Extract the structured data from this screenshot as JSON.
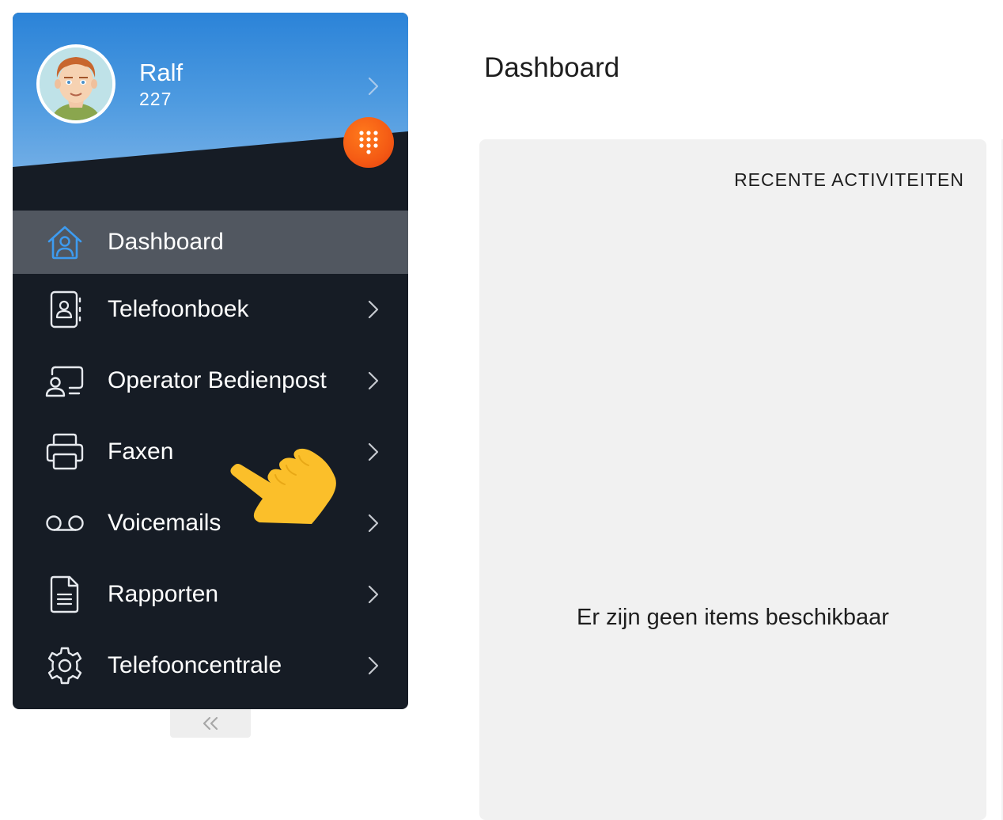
{
  "user": {
    "name": "Ralf",
    "extension": "227"
  },
  "nav": {
    "items": [
      {
        "label": "Dashboard",
        "icon": "home-icon",
        "active": true
      },
      {
        "label": "Telefoonboek",
        "icon": "contact-book-icon"
      },
      {
        "label": "Operator Bedienpost",
        "icon": "operator-console-icon"
      },
      {
        "label": "Faxen",
        "icon": "printer-icon"
      },
      {
        "label": "Voicemails",
        "icon": "voicemail-icon"
      },
      {
        "label": "Rapporten",
        "icon": "document-icon"
      },
      {
        "label": "Telefooncentrale",
        "icon": "gear-icon"
      }
    ]
  },
  "main": {
    "title": "Dashboard",
    "panel": {
      "title": "RECENTE ACTIVITEITEN",
      "empty_text": "Er zijn geen items beschikbaar"
    }
  },
  "colors": {
    "sidebar_bg": "#161c25",
    "active_item_bg": "#515760",
    "header_blue": "#4d9ae0",
    "dialpad_orange": "#f45a14",
    "pointer_yellow": "#fbbf2a",
    "panel_bg": "#f1f1f1"
  }
}
